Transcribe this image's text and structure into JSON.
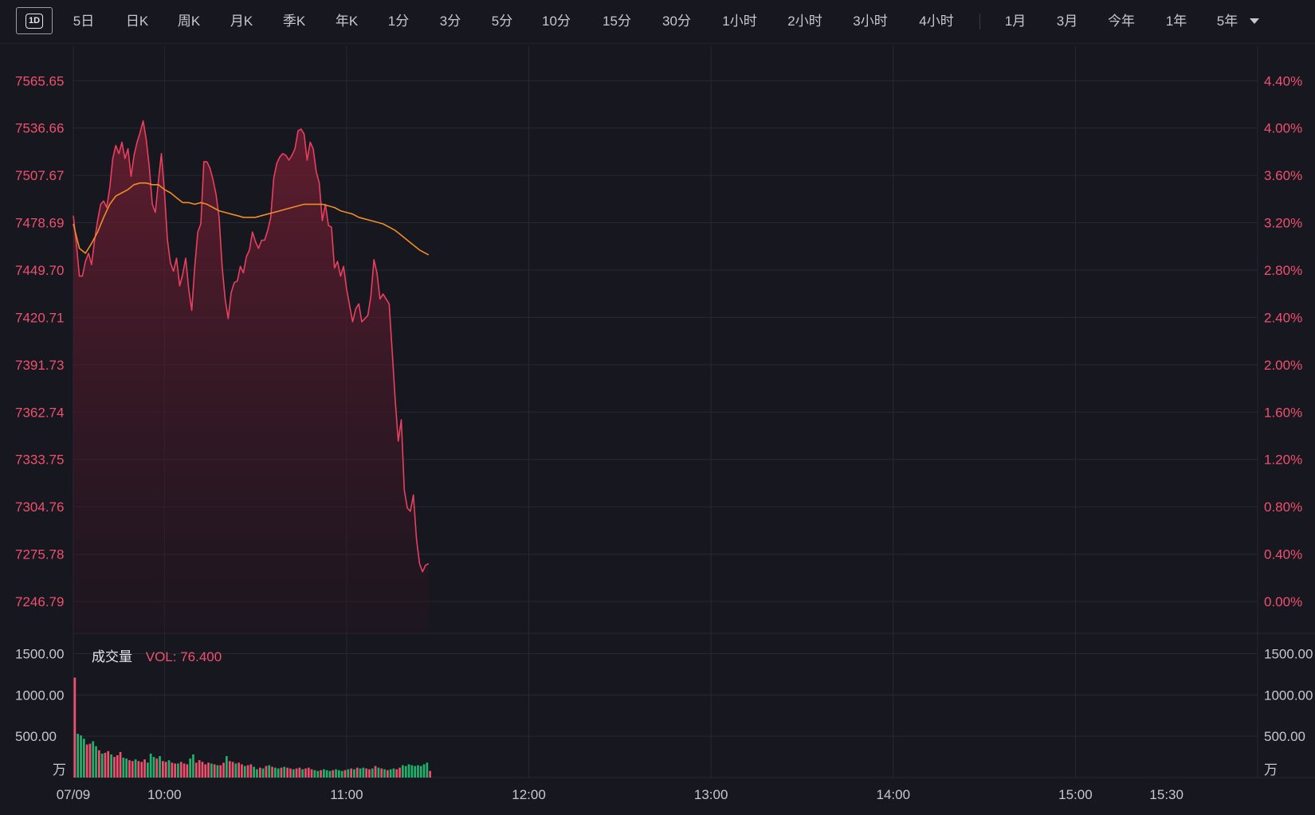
{
  "tabs": [
    "5日",
    "日K",
    "周K",
    "月K",
    "季K",
    "年K",
    "1分",
    "3分",
    "5分",
    "10分",
    "15分",
    "30分",
    "1小时",
    "2小时",
    "3小时",
    "4小时"
  ],
  "range_tabs": [
    "1月",
    "3月",
    "今年",
    "1年",
    "5年"
  ],
  "active_tab": "1D",
  "volume_legend": {
    "label": "成交量",
    "value": "VOL: 76.400"
  },
  "colors": {
    "up": "#f0506e",
    "down": "#20b26c",
    "avg": "#f08c28",
    "bg": "#16171f",
    "grid": "#262833"
  },
  "chart_data": {
    "type": "line",
    "price_ticks": [
      "7565.65",
      "7536.66",
      "7507.67",
      "7478.69",
      "7449.70",
      "7420.71",
      "7391.73",
      "7362.74",
      "7333.75",
      "7304.76",
      "7275.78",
      "7246.79"
    ],
    "pct_ticks": [
      "4.40%",
      "4.00%",
      "3.60%",
      "3.20%",
      "2.80%",
      "2.40%",
      "2.00%",
      "1.60%",
      "1.20%",
      "0.80%",
      "0.40%",
      "0.00%"
    ],
    "ylim": [
      7227.29,
      7584.8
    ],
    "volume_ticks": [
      "1500.00",
      "1000.00",
      "500.00",
      "万"
    ],
    "volume_ylim": [
      0,
      1650
    ],
    "x_ticks": [
      "07/09",
      "10:00",
      "11:00",
      "12:00",
      "13:00",
      "14:00",
      "15:00",
      "15:30"
    ],
    "x_tick_minutes": [
      0,
      30,
      90,
      150,
      210,
      270,
      330,
      360
    ],
    "x_domain_minutes": [
      0,
      390
    ],
    "price_series": [
      [
        0,
        7483
      ],
      [
        1,
        7466
      ],
      [
        2,
        7446
      ],
      [
        3,
        7446
      ],
      [
        4,
        7455
      ],
      [
        5,
        7460
      ],
      [
        6,
        7453
      ],
      [
        7,
        7468
      ],
      [
        8,
        7480
      ],
      [
        9,
        7490
      ],
      [
        10,
        7492
      ],
      [
        11,
        7488
      ],
      [
        12,
        7500
      ],
      [
        13,
        7518
      ],
      [
        14,
        7526
      ],
      [
        15,
        7521
      ],
      [
        16,
        7528
      ],
      [
        17,
        7518
      ],
      [
        18,
        7524
      ],
      [
        19,
        7507
      ],
      [
        20,
        7520
      ],
      [
        21,
        7528
      ],
      [
        22,
        7534
      ],
      [
        23,
        7541
      ],
      [
        24,
        7530
      ],
      [
        25,
        7513
      ],
      [
        26,
        7490
      ],
      [
        27,
        7485
      ],
      [
        28,
        7504
      ],
      [
        29,
        7521
      ],
      [
        30,
        7498
      ],
      [
        31,
        7468
      ],
      [
        32,
        7454
      ],
      [
        33,
        7449
      ],
      [
        34,
        7457
      ],
      [
        35,
        7440
      ],
      [
        36,
        7447
      ],
      [
        37,
        7457
      ],
      [
        38,
        7438
      ],
      [
        39,
        7425
      ],
      [
        40,
        7452
      ],
      [
        41,
        7473
      ],
      [
        42,
        7478
      ],
      [
        43,
        7516
      ],
      [
        44,
        7516
      ],
      [
        45,
        7512
      ],
      [
        46,
        7505
      ],
      [
        47,
        7496
      ],
      [
        48,
        7482
      ],
      [
        49,
        7452
      ],
      [
        50,
        7432
      ],
      [
        51,
        7420
      ],
      [
        52,
        7436
      ],
      [
        53,
        7442
      ],
      [
        54,
        7443
      ],
      [
        55,
        7452
      ],
      [
        56,
        7448
      ],
      [
        57,
        7458
      ],
      [
        58,
        7462
      ],
      [
        59,
        7473
      ],
      [
        60,
        7467
      ],
      [
        61,
        7463
      ],
      [
        62,
        7468
      ],
      [
        63,
        7468
      ],
      [
        64,
        7474
      ],
      [
        65,
        7482
      ],
      [
        66,
        7506
      ],
      [
        67,
        7515
      ],
      [
        68,
        7519
      ],
      [
        69,
        7521
      ],
      [
        70,
        7520
      ],
      [
        71,
        7517
      ],
      [
        72,
        7520
      ],
      [
        73,
        7524
      ],
      [
        74,
        7535
      ],
      [
        75,
        7536
      ],
      [
        76,
        7533
      ],
      [
        77,
        7517
      ],
      [
        78,
        7528
      ],
      [
        79,
        7524
      ],
      [
        80,
        7510
      ],
      [
        81,
        7503
      ],
      [
        82,
        7480
      ],
      [
        83,
        7490
      ],
      [
        84,
        7477
      ],
      [
        85,
        7476
      ],
      [
        86,
        7451
      ],
      [
        87,
        7455
      ],
      [
        88,
        7446
      ],
      [
        89,
        7452
      ],
      [
        90,
        7438
      ],
      [
        91,
        7428
      ],
      [
        92,
        7418
      ],
      [
        93,
        7426
      ],
      [
        94,
        7429
      ],
      [
        95,
        7418
      ],
      [
        96,
        7420
      ],
      [
        97,
        7422
      ],
      [
        98,
        7434
      ],
      [
        99,
        7456
      ],
      [
        100,
        7448
      ],
      [
        101,
        7432
      ],
      [
        102,
        7435
      ],
      [
        103,
        7432
      ],
      [
        104,
        7429
      ],
      [
        105,
        7400
      ],
      [
        106,
        7370
      ],
      [
        107,
        7345
      ],
      [
        108,
        7358
      ],
      [
        109,
        7315
      ],
      [
        110,
        7304
      ],
      [
        111,
        7302
      ],
      [
        112,
        7312
      ],
      [
        113,
        7285
      ],
      [
        114,
        7270
      ],
      [
        115,
        7265
      ],
      [
        116,
        7269
      ],
      [
        117,
        7270
      ]
    ],
    "avg_series": [
      [
        0,
        7478
      ],
      [
        2,
        7463
      ],
      [
        4,
        7460
      ],
      [
        6,
        7466
      ],
      [
        8,
        7473
      ],
      [
        10,
        7482
      ],
      [
        12,
        7490
      ],
      [
        14,
        7495
      ],
      [
        16,
        7497
      ],
      [
        18,
        7499
      ],
      [
        20,
        7502
      ],
      [
        22,
        7503
      ],
      [
        24,
        7503
      ],
      [
        26,
        7502
      ],
      [
        28,
        7502
      ],
      [
        30,
        7499
      ],
      [
        32,
        7497
      ],
      [
        34,
        7494
      ],
      [
        36,
        7491
      ],
      [
        38,
        7491
      ],
      [
        40,
        7490
      ],
      [
        42,
        7491
      ],
      [
        44,
        7490
      ],
      [
        46,
        7488
      ],
      [
        48,
        7486
      ],
      [
        50,
        7485
      ],
      [
        52,
        7484
      ],
      [
        54,
        7483
      ],
      [
        56,
        7482
      ],
      [
        58,
        7482
      ],
      [
        60,
        7482
      ],
      [
        62,
        7483
      ],
      [
        64,
        7484
      ],
      [
        66,
        7485
      ],
      [
        68,
        7486
      ],
      [
        70,
        7487
      ],
      [
        72,
        7488
      ],
      [
        74,
        7489
      ],
      [
        76,
        7490
      ],
      [
        78,
        7490
      ],
      [
        80,
        7490
      ],
      [
        82,
        7490
      ],
      [
        84,
        7489
      ],
      [
        86,
        7488
      ],
      [
        88,
        7486
      ],
      [
        90,
        7485
      ],
      [
        92,
        7484
      ],
      [
        94,
        7482
      ],
      [
        96,
        7481
      ],
      [
        98,
        7480
      ],
      [
        100,
        7479
      ],
      [
        102,
        7478
      ],
      [
        104,
        7476
      ],
      [
        106,
        7474
      ],
      [
        108,
        7471
      ],
      [
        110,
        7468
      ],
      [
        112,
        7465
      ],
      [
        114,
        7462
      ],
      [
        116,
        7460
      ],
      [
        117,
        7459
      ]
    ],
    "volume_series": [
      [
        0,
        1210,
        1
      ],
      [
        1,
        530,
        0
      ],
      [
        2,
        510,
        0
      ],
      [
        3,
        470,
        0
      ],
      [
        4,
        400,
        1
      ],
      [
        5,
        410,
        1
      ],
      [
        6,
        440,
        0
      ],
      [
        7,
        380,
        0
      ],
      [
        8,
        330,
        1
      ],
      [
        9,
        290,
        0
      ],
      [
        10,
        300,
        1
      ],
      [
        11,
        320,
        1
      ],
      [
        12,
        280,
        0
      ],
      [
        13,
        250,
        1
      ],
      [
        14,
        270,
        1
      ],
      [
        15,
        310,
        1
      ],
      [
        16,
        240,
        0
      ],
      [
        17,
        230,
        0
      ],
      [
        18,
        210,
        1
      ],
      [
        19,
        200,
        1
      ],
      [
        20,
        220,
        0
      ],
      [
        21,
        200,
        1
      ],
      [
        22,
        190,
        1
      ],
      [
        23,
        220,
        1
      ],
      [
        24,
        180,
        0
      ],
      [
        25,
        290,
        0
      ],
      [
        26,
        250,
        0
      ],
      [
        27,
        230,
        1
      ],
      [
        28,
        260,
        0
      ],
      [
        29,
        200,
        1
      ],
      [
        30,
        190,
        1
      ],
      [
        31,
        210,
        0
      ],
      [
        32,
        180,
        1
      ],
      [
        33,
        170,
        1
      ],
      [
        34,
        170,
        0
      ],
      [
        35,
        190,
        1
      ],
      [
        36,
        170,
        1
      ],
      [
        37,
        160,
        1
      ],
      [
        38,
        230,
        0
      ],
      [
        39,
        280,
        0
      ],
      [
        40,
        180,
        1
      ],
      [
        41,
        210,
        1
      ],
      [
        42,
        190,
        1
      ],
      [
        43,
        160,
        1
      ],
      [
        44,
        180,
        1
      ],
      [
        45,
        170,
        0
      ],
      [
        46,
        160,
        1
      ],
      [
        47,
        150,
        0
      ],
      [
        48,
        150,
        1
      ],
      [
        49,
        180,
        1
      ],
      [
        50,
        260,
        0
      ],
      [
        51,
        200,
        1
      ],
      [
        52,
        190,
        1
      ],
      [
        53,
        170,
        0
      ],
      [
        54,
        180,
        1
      ],
      [
        55,
        160,
        1
      ],
      [
        56,
        140,
        0
      ],
      [
        57,
        150,
        1
      ],
      [
        58,
        160,
        1
      ],
      [
        59,
        130,
        0
      ],
      [
        60,
        100,
        0
      ],
      [
        61,
        120,
        1
      ],
      [
        62,
        110,
        0
      ],
      [
        63,
        140,
        1
      ],
      [
        64,
        150,
        0
      ],
      [
        65,
        130,
        1
      ],
      [
        66,
        120,
        0
      ],
      [
        67,
        110,
        0
      ],
      [
        68,
        120,
        1
      ],
      [
        69,
        130,
        0
      ],
      [
        70,
        120,
        1
      ],
      [
        71,
        110,
        1
      ],
      [
        72,
        100,
        0
      ],
      [
        73,
        110,
        1
      ],
      [
        74,
        120,
        1
      ],
      [
        75,
        100,
        0
      ],
      [
        76,
        110,
        1
      ],
      [
        77,
        120,
        1
      ],
      [
        78,
        100,
        1
      ],
      [
        79,
        90,
        0
      ],
      [
        80,
        80,
        0
      ],
      [
        81,
        90,
        1
      ],
      [
        82,
        100,
        0
      ],
      [
        83,
        90,
        0
      ],
      [
        84,
        80,
        0
      ],
      [
        85,
        90,
        1
      ],
      [
        86,
        100,
        0
      ],
      [
        87,
        90,
        0
      ],
      [
        88,
        80,
        0
      ],
      [
        89,
        90,
        1
      ],
      [
        90,
        100,
        0
      ],
      [
        91,
        110,
        1
      ],
      [
        92,
        100,
        0
      ],
      [
        93,
        120,
        1
      ],
      [
        94,
        110,
        0
      ],
      [
        95,
        120,
        0
      ],
      [
        96,
        110,
        1
      ],
      [
        97,
        100,
        1
      ],
      [
        98,
        110,
        0
      ],
      [
        99,
        140,
        1
      ],
      [
        100,
        120,
        0
      ],
      [
        101,
        110,
        1
      ],
      [
        102,
        100,
        0
      ],
      [
        103,
        90,
        1
      ],
      [
        104,
        100,
        0
      ],
      [
        105,
        110,
        0
      ],
      [
        106,
        100,
        1
      ],
      [
        107,
        120,
        1
      ],
      [
        108,
        150,
        0
      ],
      [
        109,
        140,
        0
      ],
      [
        110,
        160,
        0
      ],
      [
        111,
        150,
        0
      ],
      [
        112,
        140,
        0
      ],
      [
        113,
        150,
        0
      ],
      [
        114,
        140,
        0
      ],
      [
        115,
        160,
        0
      ],
      [
        116,
        180,
        0
      ],
      [
        117,
        80,
        1
      ]
    ]
  }
}
